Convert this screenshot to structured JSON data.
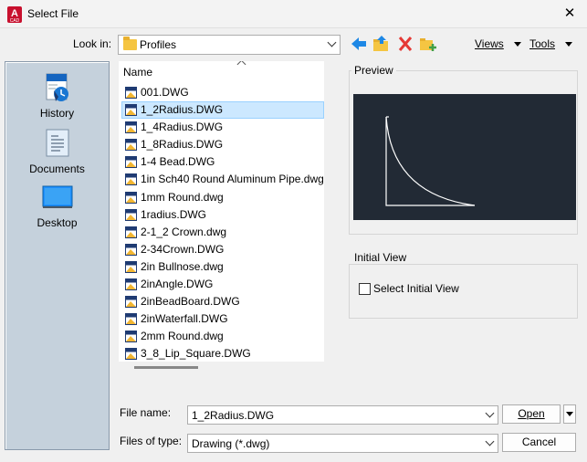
{
  "window": {
    "title": "Select File",
    "app_icon_letter": "A",
    "app_icon_sub": "CAD"
  },
  "toolbar": {
    "look_in_label": "Look in:",
    "look_in_value": "Profiles",
    "views_label": "Views",
    "tools_label": "Tools"
  },
  "places": [
    {
      "label": "History",
      "icon": "history-icon"
    },
    {
      "label": "Documents",
      "icon": "documents-icon"
    },
    {
      "label": "Desktop",
      "icon": "desktop-icon"
    }
  ],
  "file_list": {
    "column_header": "Name",
    "selected_index": 1,
    "files": [
      "001.DWG",
      "1_2Radius.DWG",
      "1_4Radius.DWG",
      "1_8Radius.DWG",
      "1-4 Bead.DWG",
      "1in Sch40 Round Aluminum Pipe.dwg",
      "1mm Round.dwg",
      "1radius.DWG",
      "2-1_2 Crown.dwg",
      "2-34Crown.DWG",
      "2in Bullnose.dwg",
      "2inAngle.DWG",
      "2inBeadBoard.DWG",
      "2inWaterfall.DWG",
      "2mm Round.dwg",
      "3_8_Lip_Square.DWG"
    ]
  },
  "preview": {
    "title": "Preview"
  },
  "initial_view": {
    "title": "Initial View",
    "checkbox_label": "Select Initial View",
    "checked": false
  },
  "footer": {
    "file_name_label": "File name:",
    "file_name_value": "1_2Radius.DWG",
    "file_type_label": "Files of type:",
    "file_type_value": "Drawing (*.dwg)",
    "open_label": "Open",
    "cancel_label": "Cancel"
  },
  "colors": {
    "accent": "#0078d7",
    "selection": "#cce8ff",
    "preview_bg": "#222a35",
    "places_bg": "#c5d1dc",
    "app_icon": "#c8102e"
  }
}
